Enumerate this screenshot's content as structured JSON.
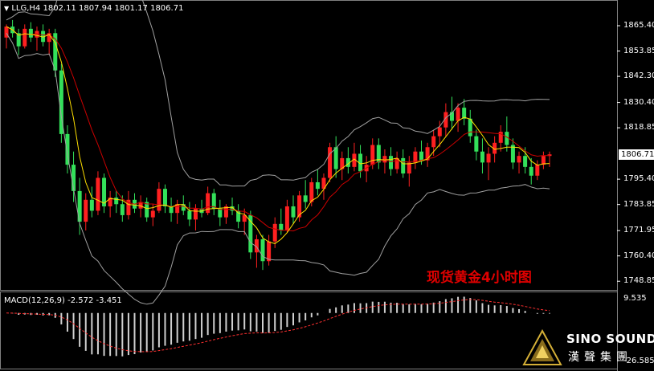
{
  "header": {
    "symbol_label": "LLG,H4",
    "ohlc": "1802.11 1807.94 1801.17 1806.71"
  },
  "macd": {
    "label": "MACD(12,26,9) -2.572 -3.451",
    "axis_top": "9.535",
    "axis_bottom": "-26.585"
  },
  "overlay": {
    "caption": "现货黄金4小时图"
  },
  "brand": {
    "name_en": "SINO SOUND",
    "name_cn": "漢聲集團"
  },
  "colors": {
    "background": "#000000",
    "bull": "#ff2020",
    "bear": "#33e05a",
    "ma_fast": "#ffe000",
    "ma_slow": "#cc0000",
    "bands": "#a0a0a0",
    "caption": "#e00000"
  },
  "chart_data": {
    "type": "candlestick",
    "timeframe": "H4",
    "y_ticks": [
      1865.4,
      1853.85,
      1842.3,
      1830.4,
      1818.85,
      1806.71,
      1795.4,
      1783.85,
      1771.95,
      1760.4,
      1748.85
    ],
    "ylim": [
      1746.0,
      1872.0
    ],
    "current_price": 1806.71,
    "candles": [
      [
        1860,
        1866,
        1855,
        1865
      ],
      [
        1865,
        1868,
        1860,
        1862
      ],
      [
        1862,
        1864,
        1852,
        1856
      ],
      [
        1856,
        1866,
        1855,
        1864
      ],
      [
        1864,
        1867,
        1858,
        1860
      ],
      [
        1860,
        1865,
        1854,
        1863
      ],
      [
        1863,
        1866,
        1856,
        1858
      ],
      [
        1858,
        1864,
        1852,
        1862
      ],
      [
        1862,
        1864,
        1842,
        1845
      ],
      [
        1845,
        1848,
        1812,
        1816
      ],
      [
        1816,
        1820,
        1798,
        1802
      ],
      [
        1802,
        1808,
        1785,
        1790
      ],
      [
        1790,
        1796,
        1770,
        1776
      ],
      [
        1776,
        1789,
        1772,
        1786
      ],
      [
        1786,
        1792,
        1778,
        1781
      ],
      [
        1781,
        1799,
        1779,
        1796
      ],
      [
        1796,
        1798,
        1780,
        1783
      ],
      [
        1783,
        1790,
        1778,
        1787
      ],
      [
        1787,
        1790,
        1780,
        1784
      ],
      [
        1784,
        1788,
        1776,
        1779
      ],
      [
        1779,
        1790,
        1777,
        1786
      ],
      [
        1786,
        1789,
        1780,
        1782
      ],
      [
        1782,
        1788,
        1778,
        1785
      ],
      [
        1785,
        1787,
        1776,
        1778
      ],
      [
        1778,
        1784,
        1774,
        1781
      ],
      [
        1781,
        1794,
        1780,
        1791
      ],
      [
        1791,
        1793,
        1780,
        1783
      ],
      [
        1783,
        1787,
        1776,
        1780
      ],
      [
        1780,
        1786,
        1775,
        1784
      ],
      [
        1784,
        1788,
        1779,
        1781
      ],
      [
        1781,
        1785,
        1774,
        1777
      ],
      [
        1777,
        1784,
        1772,
        1782
      ],
      [
        1782,
        1786,
        1778,
        1780
      ],
      [
        1780,
        1792,
        1779,
        1789
      ],
      [
        1789,
        1791,
        1779,
        1782
      ],
      [
        1782,
        1786,
        1774,
        1778
      ],
      [
        1778,
        1784,
        1775,
        1783
      ],
      [
        1783,
        1787,
        1779,
        1781
      ],
      [
        1781,
        1784,
        1773,
        1776
      ],
      [
        1776,
        1782,
        1770,
        1779
      ],
      [
        1779,
        1781,
        1759,
        1762
      ],
      [
        1762,
        1770,
        1755,
        1768
      ],
      [
        1768,
        1770,
        1754,
        1758
      ],
      [
        1758,
        1770,
        1756,
        1767
      ],
      [
        1767,
        1778,
        1764,
        1775
      ],
      [
        1775,
        1782,
        1770,
        1772
      ],
      [
        1772,
        1786,
        1771,
        1783
      ],
      [
        1783,
        1788,
        1775,
        1778
      ],
      [
        1778,
        1790,
        1776,
        1788
      ],
      [
        1788,
        1795,
        1782,
        1785
      ],
      [
        1785,
        1796,
        1783,
        1794
      ],
      [
        1794,
        1800,
        1788,
        1791
      ],
      [
        1791,
        1798,
        1786,
        1796
      ],
      [
        1796,
        1812,
        1794,
        1810
      ],
      [
        1810,
        1815,
        1796,
        1800
      ],
      [
        1800,
        1808,
        1795,
        1805
      ],
      [
        1805,
        1810,
        1798,
        1801
      ],
      [
        1801,
        1812,
        1799,
        1807
      ],
      [
        1807,
        1811,
        1796,
        1799
      ],
      [
        1799,
        1806,
        1794,
        1802
      ],
      [
        1802,
        1814,
        1800,
        1811
      ],
      [
        1811,
        1814,
        1800,
        1803
      ],
      [
        1803,
        1809,
        1798,
        1806
      ],
      [
        1806,
        1810,
        1797,
        1800
      ],
      [
        1800,
        1808,
        1798,
        1805
      ],
      [
        1805,
        1809,
        1796,
        1798
      ],
      [
        1798,
        1806,
        1792,
        1803
      ],
      [
        1803,
        1810,
        1800,
        1808
      ],
      [
        1808,
        1813,
        1802,
        1804
      ],
      [
        1804,
        1812,
        1801,
        1810
      ],
      [
        1810,
        1818,
        1806,
        1815
      ],
      [
        1815,
        1822,
        1810,
        1819
      ],
      [
        1819,
        1830,
        1815,
        1826
      ],
      [
        1826,
        1833,
        1818,
        1822
      ],
      [
        1822,
        1830,
        1817,
        1828
      ],
      [
        1828,
        1832,
        1820,
        1823
      ],
      [
        1823,
        1827,
        1812,
        1815
      ],
      [
        1815,
        1818,
        1804,
        1808
      ],
      [
        1808,
        1814,
        1798,
        1803
      ],
      [
        1803,
        1810,
        1795,
        1807
      ],
      [
        1807,
        1815,
        1803,
        1812
      ],
      [
        1812,
        1820,
        1808,
        1817
      ],
      [
        1817,
        1824,
        1808,
        1811
      ],
      [
        1811,
        1814,
        1800,
        1803
      ],
      [
        1803,
        1808,
        1798,
        1806
      ],
      [
        1806,
        1810,
        1798,
        1801
      ],
      [
        1801,
        1805,
        1793,
        1797
      ],
      [
        1797,
        1804,
        1795,
        1802
      ],
      [
        1802,
        1808,
        1800,
        1806
      ],
      [
        1806,
        1808,
        1801,
        1806.71
      ]
    ],
    "macd_range": [
      -26.585,
      9.535
    ]
  }
}
